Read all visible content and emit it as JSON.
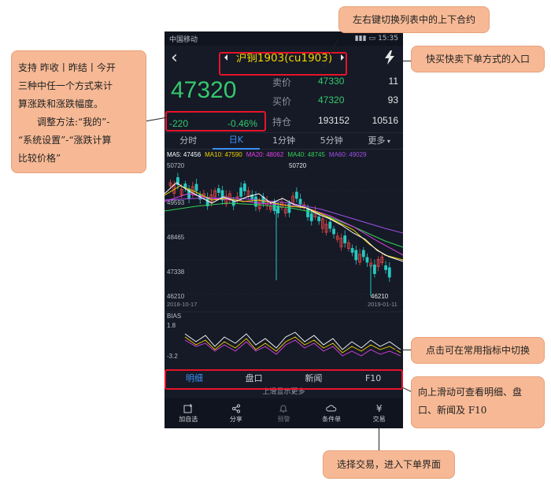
{
  "status": {
    "carrier": "中国移动",
    "time": "15:35"
  },
  "contract": {
    "name": "沪铜1903(cu1903)"
  },
  "quote": {
    "last": "47320",
    "change": "-220",
    "change_pct": "-0.46%",
    "ask_label": "卖价",
    "ask_price": "47330",
    "ask_vol": "11",
    "bid_label": "买价",
    "bid_price": "47320",
    "bid_vol": "93",
    "oi_label": "持仓",
    "oi_value": "193152",
    "oi_change": "10516"
  },
  "tabs": [
    "分时",
    "日K",
    "1分钟",
    "5分钟",
    "更多"
  ],
  "ma": {
    "ma5": "MA5: 47456",
    "ma10": "MA10: 47590",
    "ma20": "MA20: 48062",
    "ma40": "MA40: 48745",
    "ma60": "MA60: 49029"
  },
  "colors": {
    "ma5": "#ffffff",
    "ma10": "#f0d000",
    "ma20": "#e040e8",
    "ma40": "#34d058",
    "ma60": "#a050e8",
    "up": "#e84848",
    "down": "#28c8c0",
    "accent": "#3a8ff2"
  },
  "chart": {
    "y_labels": [
      "50720",
      "49593",
      "48465",
      "47338",
      "46210"
    ],
    "high_label": "50720",
    "low_label": "46210",
    "date_start": "2018-10-17",
    "date_end": "2019-01-11",
    "bias_label": "BIAS",
    "bias_top": "1.8",
    "bias_bottom": "-3.2"
  },
  "chart_data": {
    "type": "candlestick",
    "ylim": [
      46210,
      50720
    ],
    "bias_ylim": [
      -3.2,
      1.8
    ]
  },
  "bottom_tabs": [
    "明细",
    "盘口",
    "新闻",
    "F10"
  ],
  "more_hint": "上滑显示更多",
  "toolbar": [
    {
      "label": "加自选",
      "icon": "add-watchlist-icon"
    },
    {
      "label": "分享",
      "icon": "share-icon"
    },
    {
      "label": "预警",
      "icon": "bell-icon"
    },
    {
      "label": "条件单",
      "icon": "cloud-icon"
    },
    {
      "label": "交易",
      "icon": "yen-icon"
    }
  ],
  "callouts": {
    "top": "左右键切换列表中的上下合约",
    "right_top": "快买快卖下单方式的入口",
    "left_line1": "支持  昨收丨昨结丨今开",
    "left_line2": "三种中任一个方式来计",
    "left_line3": "算涨跌和涨跌幅度。",
    "left_line4": "调整方法:“我的”-",
    "left_line5": "“系统设置”-“涨跌计算",
    "left_line6": "比较价格”",
    "right_mid": "点击可在常用指标中切换",
    "right_bottom_line1": "向上滑动可查看明细、盘",
    "right_bottom_line2": "口、新闻及 F10",
    "bottom": "选择交易，进入下单界面"
  }
}
